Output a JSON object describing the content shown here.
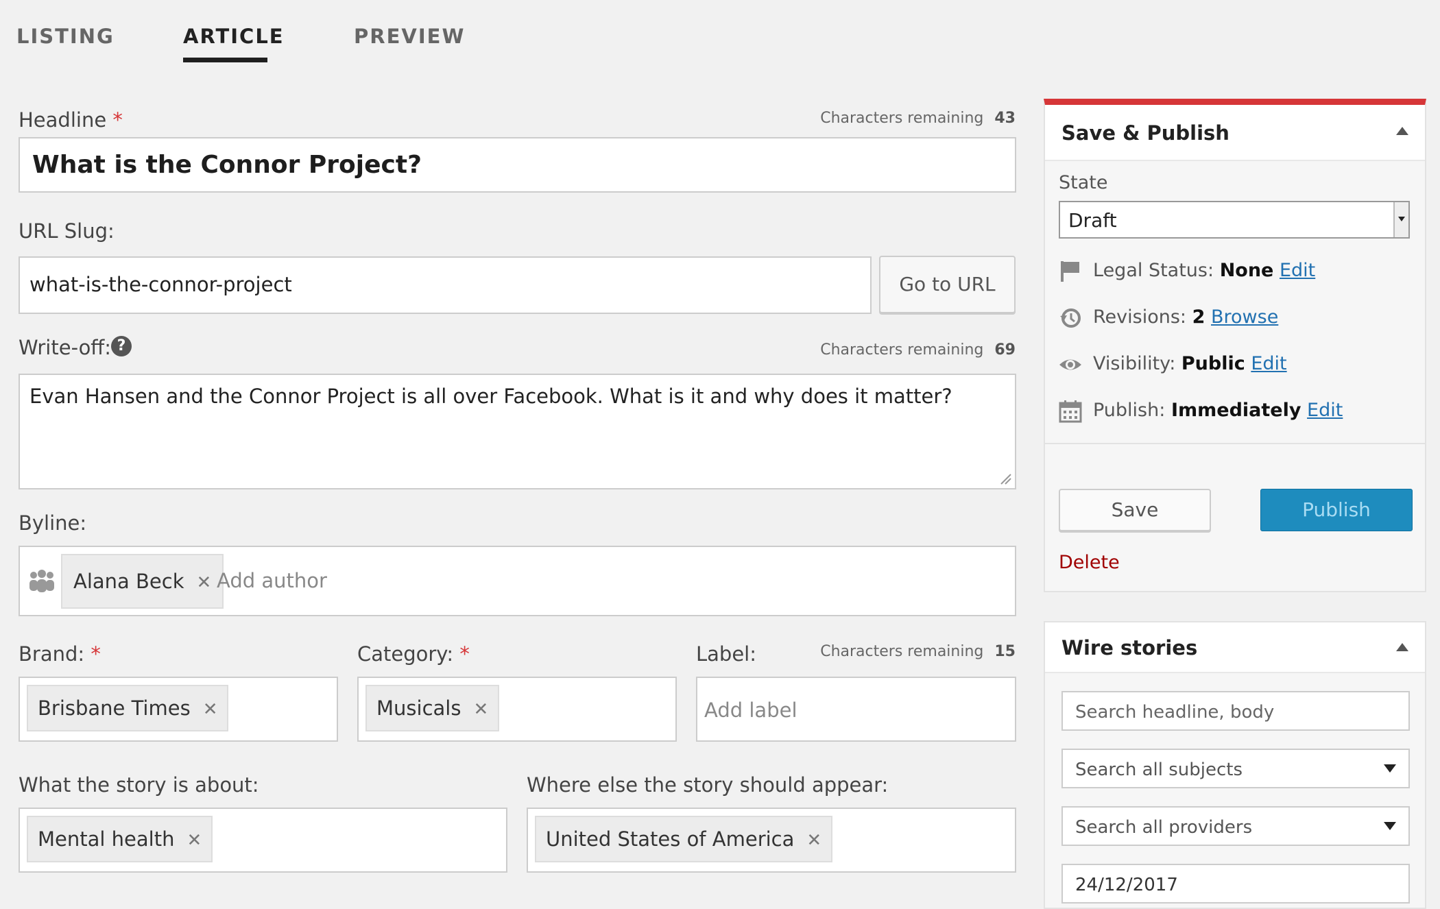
{
  "tabs": [
    {
      "label": "LISTING"
    },
    {
      "label": "ARTICLE",
      "active": true
    },
    {
      "label": "PREVIEW"
    }
  ],
  "form": {
    "headline": {
      "label": "Headline",
      "required_marker": "*",
      "chars_label": "Characters remaining",
      "chars_count": "43",
      "value": "What is the Connor Project?"
    },
    "url_slug": {
      "label": "URL Slug:",
      "value": "what-is-the-connor-project",
      "button": "Go to URL"
    },
    "write_off": {
      "label": "Write-off:",
      "help_icon": "?",
      "chars_label": "Characters remaining",
      "chars_count": "69",
      "value": "Evan Hansen and the Connor Project is all over Facebook. What is it and why does it matter?"
    },
    "byline": {
      "label": "Byline:",
      "icon": "people-icon",
      "token": "Alana Beck",
      "placeholder": "Add author"
    },
    "brand": {
      "label": "Brand:",
      "required_marker": "*",
      "token": "Brisbane Times"
    },
    "category": {
      "label": "Category:",
      "required_marker": "*",
      "token": "Musicals"
    },
    "label_field": {
      "label": "Label:",
      "chars_label": "Characters remaining",
      "chars_count": "15",
      "placeholder": "Add label"
    },
    "about": {
      "label": "What the story is about:",
      "token": "Mental health"
    },
    "appear": {
      "label": "Where else the story should appear:",
      "token": "United States of America"
    },
    "remove_symbol": "✕"
  },
  "publish_panel": {
    "title": "Save & Publish",
    "state_label": "State",
    "state_value": "Draft",
    "legal_label": "Legal Status:",
    "legal_value": "None",
    "legal_link": "Edit",
    "revisions_label": "Revisions:",
    "revisions_value": "2",
    "revisions_link": "Browse",
    "visibility_label": "Visibility:",
    "visibility_value": "Public",
    "visibility_link": "Edit",
    "publish_label": "Publish:",
    "publish_value": "Immediately",
    "publish_link": "Edit",
    "save_button": "Save",
    "publish_button": "Publish",
    "delete_link": "Delete",
    "colors": {
      "top_bar": "#d63638",
      "publish_bg": "#1e8cbe",
      "delete": "#a00000",
      "link": "#2271b1"
    }
  },
  "wire_panel": {
    "title": "Wire stories",
    "search_placeholder": "Search headline, body",
    "subjects_select": "Search all subjects",
    "providers_select": "Search all providers",
    "date_value": "24/12/2017"
  }
}
